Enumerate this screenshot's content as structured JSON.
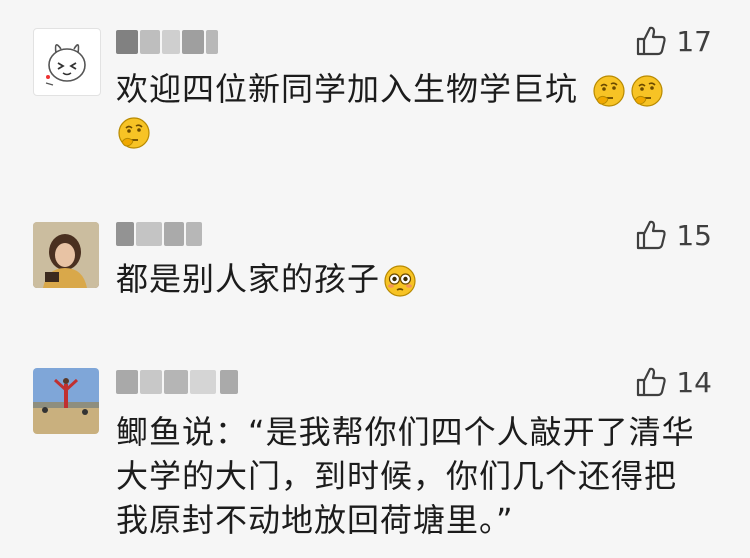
{
  "comments": [
    {
      "avatar_icon": "cartoon-rabbit-avatar",
      "likes": "17",
      "text": "欢迎四位新同学加入生物学巨坑",
      "emojis": [
        "thinking-face-emoji",
        "thinking-face-emoji",
        "thinking-face-emoji"
      ]
    },
    {
      "avatar_icon": "woman-photo-avatar",
      "likes": "15",
      "text": "都是别人家的孩子",
      "emojis": [
        "flushed-face-emoji"
      ]
    },
    {
      "avatar_icon": "beach-photo-avatar",
      "likes": "14",
      "text_lines": [
        "鲫鱼说：“是我帮你们四个人敲开了清华",
        "大学的大门，到时候，你们几个还得把",
        "我原封不动地放回荷塘里。”"
      ]
    }
  ],
  "icons": {
    "like": "thumbs-up-icon"
  },
  "colors": {
    "background": "#f6f6f6",
    "text": "#1c1c1c",
    "like": "#3f3f3f",
    "emoji": "#f7c325"
  }
}
